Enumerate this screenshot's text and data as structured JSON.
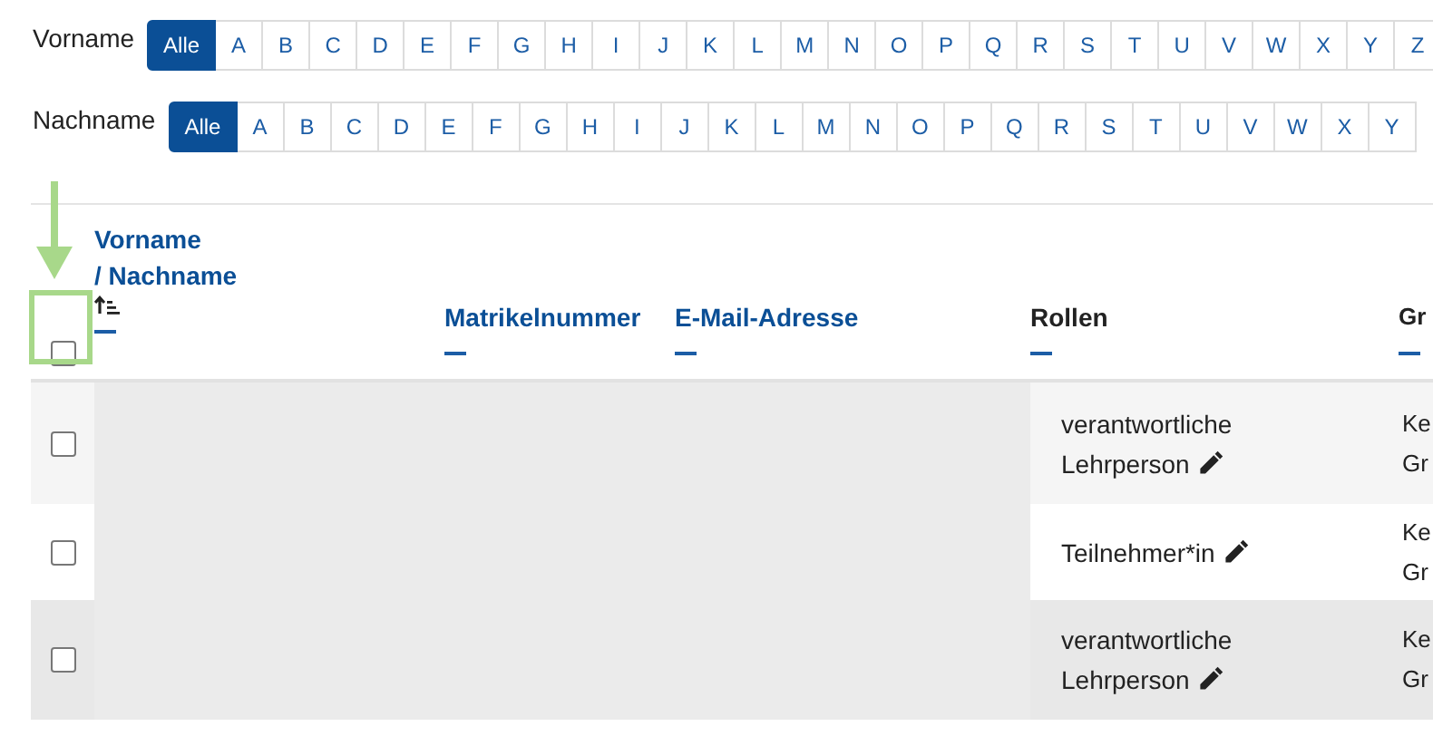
{
  "filters": [
    {
      "label": "Vorname",
      "options": [
        {
          "label": "Alle",
          "selected": true
        },
        {
          "label": "A",
          "selected": false
        },
        {
          "label": "B",
          "selected": false
        },
        {
          "label": "C",
          "selected": false
        },
        {
          "label": "D",
          "selected": false
        },
        {
          "label": "E",
          "selected": false
        },
        {
          "label": "F",
          "selected": false
        },
        {
          "label": "G",
          "selected": false
        },
        {
          "label": "H",
          "selected": false
        },
        {
          "label": "I",
          "selected": false
        },
        {
          "label": "J",
          "selected": false
        },
        {
          "label": "K",
          "selected": false
        },
        {
          "label": "L",
          "selected": false
        },
        {
          "label": "M",
          "selected": false
        },
        {
          "label": "N",
          "selected": false
        },
        {
          "label": "O",
          "selected": false
        },
        {
          "label": "P",
          "selected": false
        },
        {
          "label": "Q",
          "selected": false
        },
        {
          "label": "R",
          "selected": false
        },
        {
          "label": "S",
          "selected": false
        },
        {
          "label": "T",
          "selected": false
        },
        {
          "label": "U",
          "selected": false
        },
        {
          "label": "V",
          "selected": false
        },
        {
          "label": "W",
          "selected": false
        },
        {
          "label": "X",
          "selected": false
        },
        {
          "label": "Y",
          "selected": false
        },
        {
          "label": "Z",
          "selected": false
        }
      ]
    },
    {
      "label": "Nachname",
      "options": [
        {
          "label": "Alle",
          "selected": true
        },
        {
          "label": "A",
          "selected": false
        },
        {
          "label": "B",
          "selected": false
        },
        {
          "label": "C",
          "selected": false
        },
        {
          "label": "D",
          "selected": false
        },
        {
          "label": "E",
          "selected": false
        },
        {
          "label": "F",
          "selected": false
        },
        {
          "label": "G",
          "selected": false
        },
        {
          "label": "H",
          "selected": false
        },
        {
          "label": "I",
          "selected": false
        },
        {
          "label": "J",
          "selected": false
        },
        {
          "label": "K",
          "selected": false
        },
        {
          "label": "L",
          "selected": false
        },
        {
          "label": "M",
          "selected": false
        },
        {
          "label": "N",
          "selected": false
        },
        {
          "label": "O",
          "selected": false
        },
        {
          "label": "P",
          "selected": false
        },
        {
          "label": "Q",
          "selected": false
        },
        {
          "label": "R",
          "selected": false
        },
        {
          "label": "S",
          "selected": false
        },
        {
          "label": "T",
          "selected": false
        },
        {
          "label": "U",
          "selected": false
        },
        {
          "label": "V",
          "selected": false
        },
        {
          "label": "W",
          "selected": false
        },
        {
          "label": "X",
          "selected": false
        },
        {
          "label": "Y",
          "selected": false
        }
      ]
    }
  ],
  "table": {
    "select_all": {
      "checked": false
    },
    "columns": [
      {
        "links": [
          "Vorname",
          "/ Nachname"
        ],
        "sortable": true,
        "sorted": true
      },
      {
        "links": [
          "Matrikelnummer"
        ],
        "sortable": true,
        "sorted": false
      },
      {
        "links": [
          "E-Mail-Adresse"
        ],
        "sortable": true,
        "sorted": false
      },
      {
        "links": [
          "Rollen"
        ],
        "sortable": false,
        "sorted": false
      },
      {
        "links": [
          "Gr"
        ],
        "sortable": false,
        "sorted": false
      }
    ],
    "rows": [
      {
        "checked": false,
        "highlighted": false,
        "role": "verantwortliche Lehrperson",
        "column_5": [
          "Ke",
          "Gr"
        ]
      },
      {
        "checked": false,
        "highlighted": false,
        "role": "Teilnehmer*in",
        "column_5": [
          "Ke",
          "Gr"
        ]
      },
      {
        "checked": false,
        "highlighted": true,
        "role": "verantwortliche Lehrperson",
        "column_5": [
          "Ke",
          "Gr"
        ]
      }
    ]
  },
  "annotation": {
    "highlight_select_all": true
  }
}
